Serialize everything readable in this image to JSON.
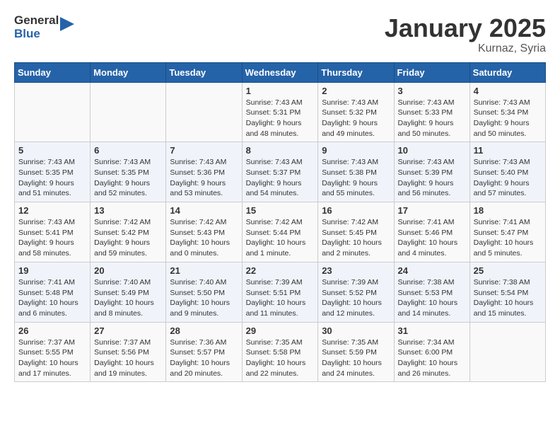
{
  "header": {
    "logo_general": "General",
    "logo_blue": "Blue",
    "month": "January 2025",
    "location": "Kurnaz, Syria"
  },
  "weekdays": [
    "Sunday",
    "Monday",
    "Tuesday",
    "Wednesday",
    "Thursday",
    "Friday",
    "Saturday"
  ],
  "weeks": [
    [
      {
        "day": null
      },
      {
        "day": null
      },
      {
        "day": null
      },
      {
        "day": 1,
        "sunrise": "7:43 AM",
        "sunset": "5:31 PM",
        "daylight": "9 hours and 48 minutes."
      },
      {
        "day": 2,
        "sunrise": "7:43 AM",
        "sunset": "5:32 PM",
        "daylight": "9 hours and 49 minutes."
      },
      {
        "day": 3,
        "sunrise": "7:43 AM",
        "sunset": "5:33 PM",
        "daylight": "9 hours and 50 minutes."
      },
      {
        "day": 4,
        "sunrise": "7:43 AM",
        "sunset": "5:34 PM",
        "daylight": "9 hours and 50 minutes."
      }
    ],
    [
      {
        "day": 5,
        "sunrise": "7:43 AM",
        "sunset": "5:35 PM",
        "daylight": "9 hours and 51 minutes."
      },
      {
        "day": 6,
        "sunrise": "7:43 AM",
        "sunset": "5:35 PM",
        "daylight": "9 hours and 52 minutes."
      },
      {
        "day": 7,
        "sunrise": "7:43 AM",
        "sunset": "5:36 PM",
        "daylight": "9 hours and 53 minutes."
      },
      {
        "day": 8,
        "sunrise": "7:43 AM",
        "sunset": "5:37 PM",
        "daylight": "9 hours and 54 minutes."
      },
      {
        "day": 9,
        "sunrise": "7:43 AM",
        "sunset": "5:38 PM",
        "daylight": "9 hours and 55 minutes."
      },
      {
        "day": 10,
        "sunrise": "7:43 AM",
        "sunset": "5:39 PM",
        "daylight": "9 hours and 56 minutes."
      },
      {
        "day": 11,
        "sunrise": "7:43 AM",
        "sunset": "5:40 PM",
        "daylight": "9 hours and 57 minutes."
      }
    ],
    [
      {
        "day": 12,
        "sunrise": "7:43 AM",
        "sunset": "5:41 PM",
        "daylight": "9 hours and 58 minutes."
      },
      {
        "day": 13,
        "sunrise": "7:42 AM",
        "sunset": "5:42 PM",
        "daylight": "9 hours and 59 minutes."
      },
      {
        "day": 14,
        "sunrise": "7:42 AM",
        "sunset": "5:43 PM",
        "daylight": "10 hours and 0 minutes."
      },
      {
        "day": 15,
        "sunrise": "7:42 AM",
        "sunset": "5:44 PM",
        "daylight": "10 hours and 1 minute."
      },
      {
        "day": 16,
        "sunrise": "7:42 AM",
        "sunset": "5:45 PM",
        "daylight": "10 hours and 2 minutes."
      },
      {
        "day": 17,
        "sunrise": "7:41 AM",
        "sunset": "5:46 PM",
        "daylight": "10 hours and 4 minutes."
      },
      {
        "day": 18,
        "sunrise": "7:41 AM",
        "sunset": "5:47 PM",
        "daylight": "10 hours and 5 minutes."
      }
    ],
    [
      {
        "day": 19,
        "sunrise": "7:41 AM",
        "sunset": "5:48 PM",
        "daylight": "10 hours and 6 minutes."
      },
      {
        "day": 20,
        "sunrise": "7:40 AM",
        "sunset": "5:49 PM",
        "daylight": "10 hours and 8 minutes."
      },
      {
        "day": 21,
        "sunrise": "7:40 AM",
        "sunset": "5:50 PM",
        "daylight": "10 hours and 9 minutes."
      },
      {
        "day": 22,
        "sunrise": "7:39 AM",
        "sunset": "5:51 PM",
        "daylight": "10 hours and 11 minutes."
      },
      {
        "day": 23,
        "sunrise": "7:39 AM",
        "sunset": "5:52 PM",
        "daylight": "10 hours and 12 minutes."
      },
      {
        "day": 24,
        "sunrise": "7:38 AM",
        "sunset": "5:53 PM",
        "daylight": "10 hours and 14 minutes."
      },
      {
        "day": 25,
        "sunrise": "7:38 AM",
        "sunset": "5:54 PM",
        "daylight": "10 hours and 15 minutes."
      }
    ],
    [
      {
        "day": 26,
        "sunrise": "7:37 AM",
        "sunset": "5:55 PM",
        "daylight": "10 hours and 17 minutes."
      },
      {
        "day": 27,
        "sunrise": "7:37 AM",
        "sunset": "5:56 PM",
        "daylight": "10 hours and 19 minutes."
      },
      {
        "day": 28,
        "sunrise": "7:36 AM",
        "sunset": "5:57 PM",
        "daylight": "10 hours and 20 minutes."
      },
      {
        "day": 29,
        "sunrise": "7:35 AM",
        "sunset": "5:58 PM",
        "daylight": "10 hours and 22 minutes."
      },
      {
        "day": 30,
        "sunrise": "7:35 AM",
        "sunset": "5:59 PM",
        "daylight": "10 hours and 24 minutes."
      },
      {
        "day": 31,
        "sunrise": "7:34 AM",
        "sunset": "6:00 PM",
        "daylight": "10 hours and 26 minutes."
      },
      {
        "day": null
      }
    ]
  ]
}
